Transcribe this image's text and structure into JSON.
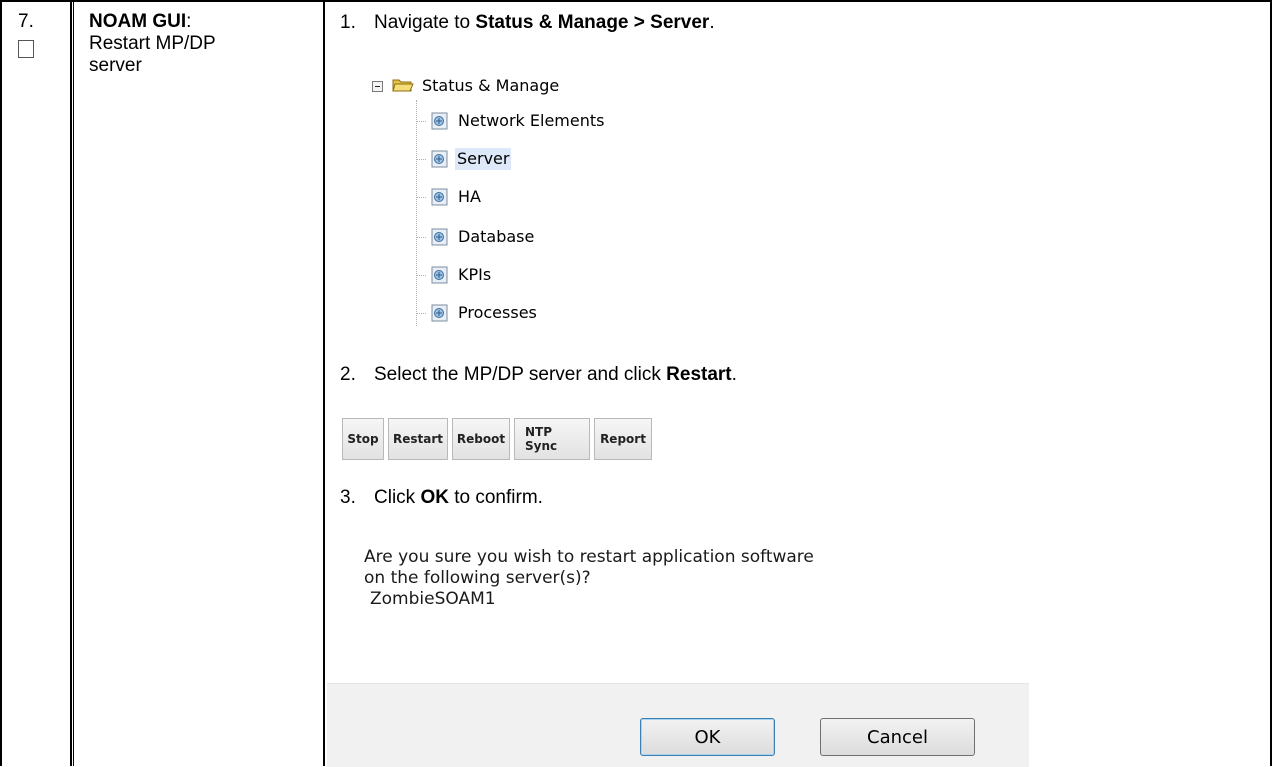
{
  "step": {
    "number": "7.",
    "title_bold": "NOAM GUI",
    "title_colon": ":",
    "title_rest_line1": "Restart MP/DP",
    "title_rest_line2": "server"
  },
  "instructions": {
    "s1": {
      "num": "1.",
      "pre": "Navigate to ",
      "bold": "Status & Manage > Server",
      "post": "."
    },
    "s2": {
      "num": "2.",
      "pre": "Select the MP/DP server and click ",
      "bold": "Restart",
      "post": "."
    },
    "s3": {
      "num": "3.",
      "pre": "Click ",
      "bold": "OK",
      "post": " to confirm."
    }
  },
  "tree": {
    "root": "Status & Manage",
    "items": [
      "Network Elements",
      "Server",
      "HA",
      "Database",
      "KPIs",
      "Processes"
    ],
    "selected": "Server"
  },
  "buttons": [
    "Stop",
    "Restart",
    "Reboot",
    "NTP Sync",
    "Report"
  ],
  "dialog": {
    "line1": "Are you sure you wish to restart application software",
    "line2": "on the following server(s)?",
    "server": "ZombieSOAM1",
    "ok_label": "OK",
    "cancel_label": "Cancel"
  },
  "colors": {
    "selection_bg": "#dde9f8",
    "footer_bg": "#f1f1f1",
    "ok_border": "#3c7fb1"
  }
}
